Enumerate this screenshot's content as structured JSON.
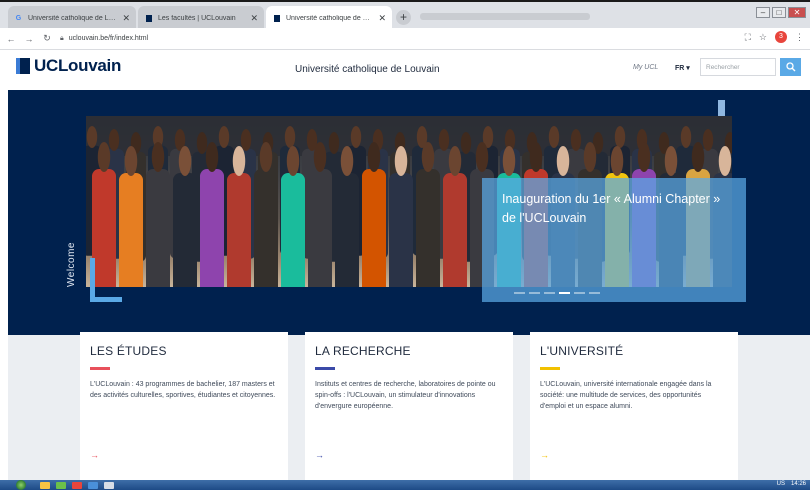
{
  "browser": {
    "tabs": [
      {
        "title": "Université catholique de Louva...",
        "favicon": "google-g"
      },
      {
        "title": "Les facultés | UCLouvain",
        "favicon": "ucl-square"
      },
      {
        "title": "Université catholique de Louva...",
        "favicon": "ucl-square",
        "active": true
      }
    ],
    "new_tab": "+",
    "url": "uclouvain.be/fr/index.html",
    "profile_initial": "3"
  },
  "header": {
    "logo_text": "UCLouvain",
    "site_title": "Université catholique de Louvain",
    "my_ucl": "My UCL",
    "language": "FR ▾",
    "search_placeholder": "Rechercher"
  },
  "hero": {
    "side_label": "Welcome",
    "caption": "Inauguration du 1er « Alumni Chapter » de l'UCLouvain",
    "slides_count": 6,
    "active_slide": 4
  },
  "cards": [
    {
      "title": "LES ÉTUDES",
      "text": "L'UCLouvain : 43 programmes de bachelier, 187 masters et des activités culturelles, sportives, étudiantes et citoyennes.",
      "accent": "#e8505b",
      "arrow": "→"
    },
    {
      "title": "LA RECHERCHE",
      "text": "Instituts et centres de recherche, laboratoires de pointe ou spin-offs : l'UCLouvain, un stimulateur d'innovations d'envergure européenne.",
      "accent": "#3b4aa8",
      "arrow": "→"
    },
    {
      "title": "L'UNIVERSITÉ",
      "text": "L'UCLouvain, université internationale engagée dans la société: une multitude de services, des opportunités d'emploi et un espace alumni.",
      "accent": "#f2c100",
      "arrow": "→"
    }
  ],
  "taskbar": {
    "locale": "US",
    "time": "14:26"
  }
}
